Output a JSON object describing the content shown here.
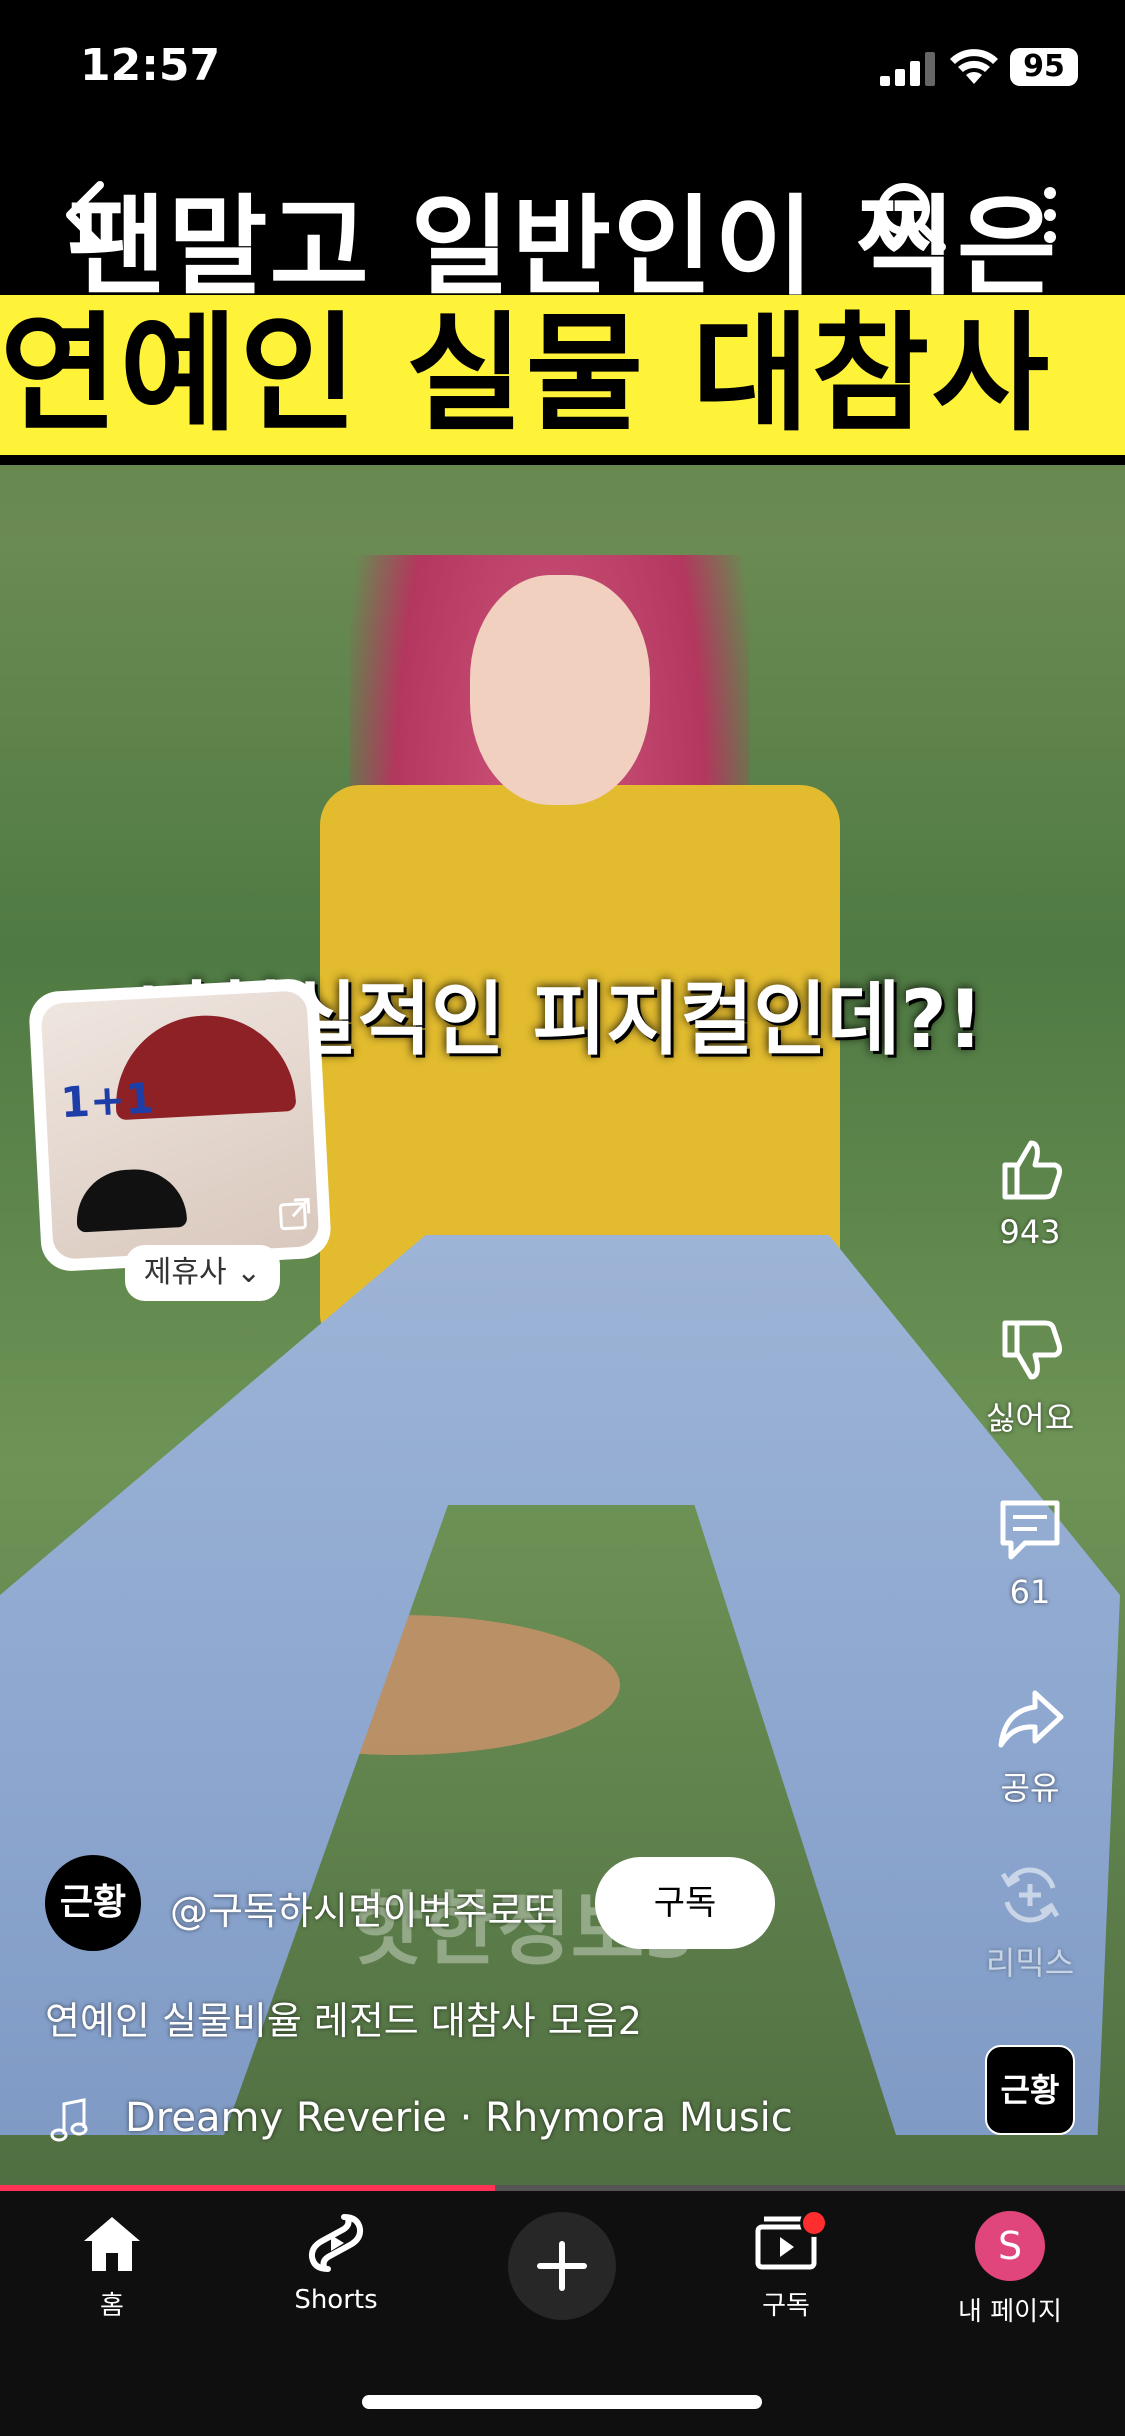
{
  "status_bar": {
    "time": "12:57",
    "battery": "95"
  },
  "video": {
    "title_line1": "팬말고 일반인이 찍은",
    "title_line2": "연예인 실물 대참사",
    "caption": "비현실적인 피지컬인데?!",
    "watermark": "핫한정보s"
  },
  "ad": {
    "badge": "1+1",
    "label": "제휴사"
  },
  "actions": {
    "like_count": "943",
    "dislike_label": "싫어요",
    "comment_count": "61",
    "share_label": "공유",
    "remix_label": "리믹스"
  },
  "channel": {
    "avatar_text": "근황",
    "handle": "@구독하시면이번주로또",
    "subscribe_label": "구독"
  },
  "video_title": "연예인 실물비율 레전드 대참사 모음2",
  "music": {
    "text": "Dreamy Reverie · Rhymora Music"
  },
  "remix_thumb": "근황",
  "progress": {
    "fraction": 0.44,
    "color": "#ff3355"
  },
  "nav": {
    "home": "홈",
    "shorts": "Shorts",
    "subscriptions": "구독",
    "my_page": "내 페이지",
    "profile_initial": "S"
  }
}
